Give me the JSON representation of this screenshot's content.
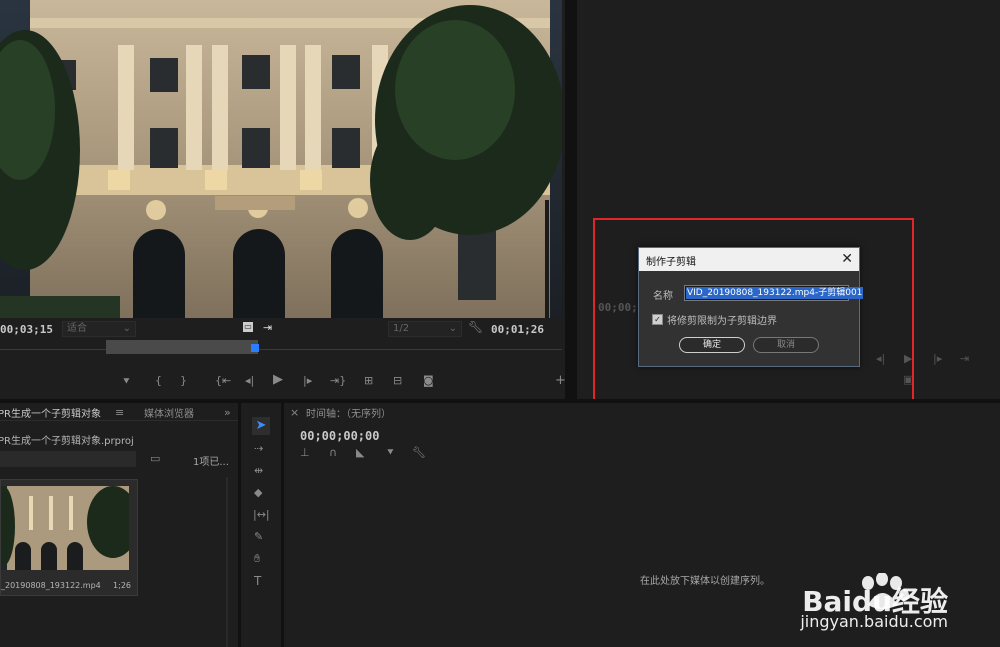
{
  "source_monitor": {
    "timecode_in": "00;03;15",
    "fit_label": "适合",
    "resolution_label": "1/2",
    "timecode_out": "00;01;26"
  },
  "program_monitor": {
    "timecode": "00;00;0"
  },
  "dialog": {
    "title": "制作子剪辑",
    "close": "✕",
    "name_label": "名称",
    "name_value": "VID_20190808_193122.mp4-子剪辑001",
    "checkbox_label": "将修剪限制为子剪辑边界",
    "checkbox_checked": true,
    "ok_label": "确定",
    "cancel_label": "取消"
  },
  "project": {
    "tab_label": "PR生成一个子剪辑对象",
    "tab2_label": "媒体浏览器",
    "file_name": "PR生成一个子剪辑对象.prproj",
    "count_label": "1项已...",
    "clip_name": "_20190808_193122.mp4",
    "clip_duration": "1;26"
  },
  "timeline": {
    "tab_label": "时间轴：（无序列）",
    "timecode": "00;00;00;00",
    "drop_hint": "在此处放下媒体以创建序列。"
  },
  "watermark": {
    "brand": "Baidu经验",
    "url": "jingyan.baidu.com"
  },
  "colors": {
    "highlight_box": "#e0262b",
    "accent_blue": "#2a67c9",
    "panel_bg": "#1e1e1e"
  }
}
